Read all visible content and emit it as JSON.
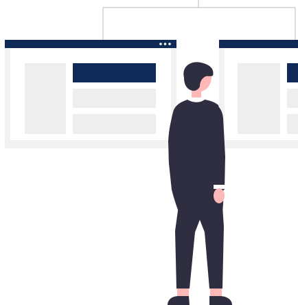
{
  "illustration": {
    "colors": {
      "background": "#ffffff",
      "frame_shadow": "#f2f2f2",
      "window_body": "#ffffff",
      "header_bar": "#0f2a56",
      "header_dots": "#ffffff",
      "placeholder_block": "#eeeeee",
      "connector_line": "#c8c8c8",
      "suit": "#2f2e41",
      "hair": "#2f2e41",
      "skin": "#ffb8b8",
      "shirt": "#ffffff"
    },
    "windows": [
      {
        "name": "left-window",
        "header_dot_count": 3,
        "highlighted_block": "top-right"
      },
      {
        "name": "right-window",
        "header_dot_count": 0,
        "highlighted_block": "top-right"
      }
    ],
    "person": {
      "pose": "standing-back-view",
      "outfit": "dark-suit"
    }
  }
}
